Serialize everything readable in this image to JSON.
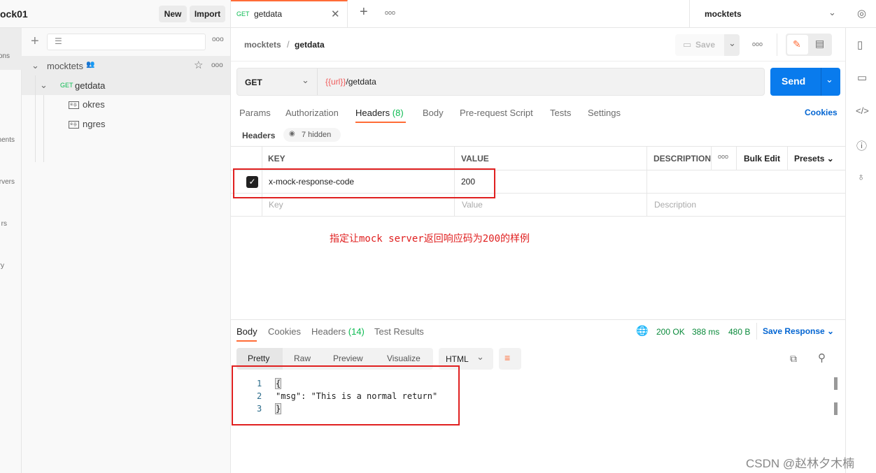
{
  "workspace": {
    "title": "ock01",
    "new_label": "New",
    "import_label": "Import"
  },
  "nav": [
    "ons",
    "ments",
    "rvers",
    "rs",
    "ry"
  ],
  "sidebar": {
    "collection": "mocktets",
    "request_method": "GET",
    "request_name": "getdata",
    "examples": [
      "okres",
      "ngres"
    ]
  },
  "tabbar": {
    "tab_method": "GET",
    "tab_name": "getdata",
    "environment": "mocktets"
  },
  "breadcrumb": {
    "parent": "mocktets",
    "sep": "/",
    "current": "getdata",
    "save_label": "Save"
  },
  "request": {
    "method": "GET",
    "url_var": "{{url}}",
    "url_path": "/getdata",
    "send_label": "Send"
  },
  "req_tabs": [
    {
      "label": "Params"
    },
    {
      "label": "Authorization"
    },
    {
      "label": "Headers",
      "count": "(8)",
      "active": true
    },
    {
      "label": "Body"
    },
    {
      "label": "Pre-request Script"
    },
    {
      "label": "Tests"
    },
    {
      "label": "Settings"
    }
  ],
  "cookies_label": "Cookies",
  "headers_sub": {
    "label": "Headers",
    "hidden": "7 hidden"
  },
  "table": {
    "columns": [
      "KEY",
      "VALUE",
      "DESCRIPTION"
    ],
    "bulk_edit": "Bulk Edit",
    "presets": "Presets",
    "rows": [
      {
        "checked": true,
        "key": "x-mock-response-code",
        "value": "200",
        "description": ""
      }
    ],
    "placeholder": {
      "key": "Key",
      "value": "Value",
      "description": "Description"
    }
  },
  "annotation": "指定让mock server返回响应码为200的样例",
  "response": {
    "tabs": [
      {
        "label": "Body",
        "active": true
      },
      {
        "label": "Cookies"
      },
      {
        "label": "Headers",
        "count": "(14)"
      },
      {
        "label": "Test Results"
      }
    ],
    "status": "200 OK",
    "time": "388 ms",
    "size": "480 B",
    "save_response": "Save Response",
    "views": [
      "Pretty",
      "Raw",
      "Preview",
      "Visualize"
    ],
    "format": "HTML",
    "lines": [
      {
        "n": "1",
        "text": "{"
      },
      {
        "n": "2",
        "text": "\"msg\": \"This is a normal return\""
      },
      {
        "n": "3",
        "text": "}"
      }
    ]
  },
  "watermark": "CSDN @赵林夕木楠",
  "colors": {
    "accent": "#ff6c37",
    "send": "#097bed",
    "get": "#0cbb52",
    "link": "#0265d2",
    "annotation": "#e02020"
  }
}
